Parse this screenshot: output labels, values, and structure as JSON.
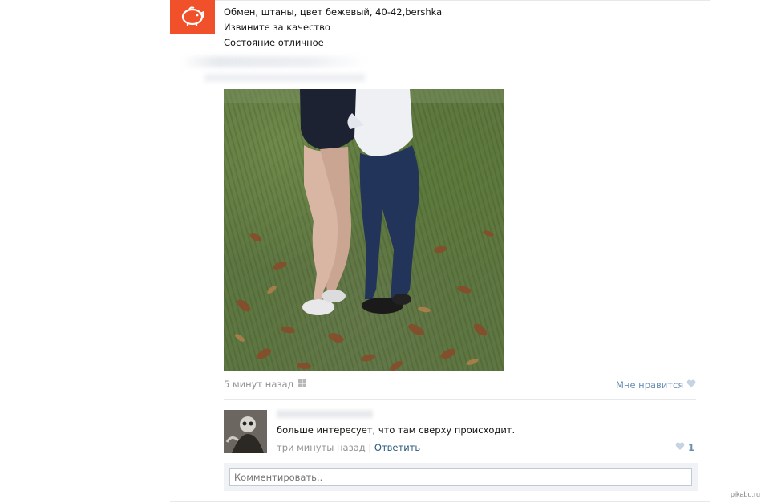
{
  "post": {
    "lines": [
      "Обмен, штаны, цвет бежевый, 40-42,bershka",
      "Извините за качество",
      "Состояние отличное"
    ],
    "time": "5 минут назад",
    "like_label": "Мне нравится"
  },
  "comment": {
    "text": "больше интересует, что там сверху происходит.",
    "time": "три минуты назад",
    "separator": "|",
    "reply_label": "Ответить",
    "like_count": "1"
  },
  "comment_form": {
    "placeholder": "Комментировать.."
  },
  "watermark": "pikabu.ru",
  "colors": {
    "group_avatar_bg": "#f0502a",
    "link": "#2b587a",
    "like": "#6a8fb7",
    "meta": "#939393"
  },
  "icons": {
    "group_avatar": "piggy-bank-icon",
    "post_source": "windows-icon",
    "like": "heart-icon"
  }
}
